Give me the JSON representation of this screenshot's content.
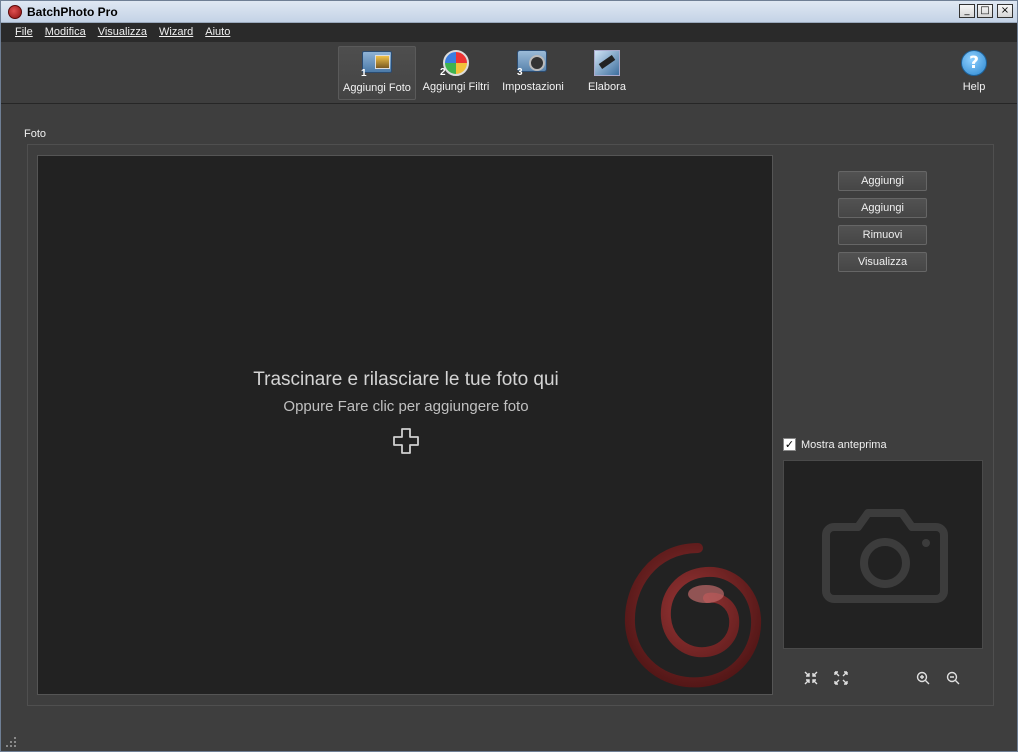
{
  "window": {
    "title": "BatchPhoto Pro"
  },
  "window_buttons": {
    "minimize": "_",
    "maximize": "□",
    "close": "×"
  },
  "menu": [
    "File",
    "Modifica",
    "Visualizza",
    "Wizard",
    "Aiuto"
  ],
  "toolbar": {
    "tools": [
      {
        "label": "Aggiungi Foto",
        "step": "1",
        "icon": "add-photos-icon",
        "active": true
      },
      {
        "label": "Aggiungi Filtri",
        "step": "2",
        "icon": "filters-icon",
        "active": false
      },
      {
        "label": "Impostazioni",
        "step": "3",
        "icon": "settings-camera-icon",
        "active": false
      },
      {
        "label": "Elabora",
        "step": "",
        "icon": "process-icon",
        "active": false
      }
    ],
    "help": {
      "label": "Help",
      "icon": "help-icon",
      "glyph": "?"
    }
  },
  "photos_group": {
    "label": "Foto",
    "drop_title": "Trascinare e rilasciare le tue foto qui",
    "drop_subtitle": "Oppure Fare clic per aggiungere foto"
  },
  "side_buttons": [
    "Aggiungi",
    "Aggiungi",
    "Rimuovi",
    "Visualizza"
  ],
  "preview": {
    "checkbox_label": "Mostra anteprima",
    "checked": true,
    "check_glyph": "✓"
  },
  "preview_tools": [
    "fit-icon",
    "expand-icon",
    "zoom-in-icon",
    "zoom-out-icon"
  ],
  "colors": {
    "accent_red": "#8a1f1f",
    "background": "#3e3e3e",
    "drop_zone": "#222222"
  }
}
